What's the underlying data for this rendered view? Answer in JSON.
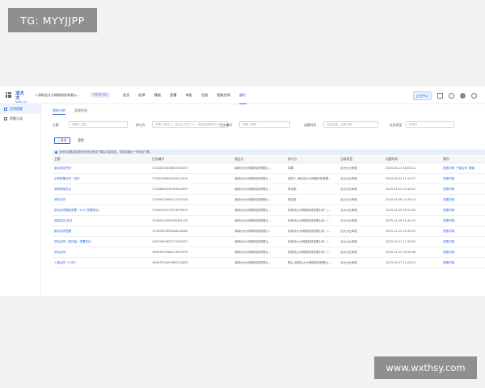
{
  "watermarks": {
    "top_left": "TG: MYYJJPP",
    "bottom_right": "www.wxthsy.com"
  },
  "header": {
    "logo_text": "法大大",
    "logo_sub": "fadada.com",
    "company": "＋深圳法大大网络科技有限公...",
    "company_badge": "已实名认证",
    "nav": [
      "首页",
      "起草",
      "模板",
      "签署",
      "审批",
      "归档",
      "智能合同",
      "履约"
    ],
    "active_nav_index": 7,
    "right_button": "企业中心"
  },
  "sidebar": {
    "items": [
      "定期提醒",
      "提醒记录"
    ],
    "active_index": 0
  },
  "tabs": {
    "items": [
      "我参与的",
      "全部任务"
    ],
    "active_index": 0
  },
  "filters": {
    "subject": {
      "label": "主题",
      "placeholder": "请输入主题"
    },
    "participant": {
      "label": "参与方",
      "placeholder": "请输入相对方，或企业下的个人，多选或选择参与方"
    },
    "contract_no": {
      "label": "任务编号",
      "placeholder": "请输入编号"
    },
    "date_range": {
      "label": "创建时间",
      "start": "开始日期",
      "sep": "-",
      "end": "结束日期"
    },
    "type": {
      "label": "任务类型",
      "placeholder": "请选择"
    },
    "query_button": "查询",
    "reset_button": "重置"
  },
  "notice": "多份合同数量较多时分批次完成下载后才能发送，仅保存最近一份导出下载。",
  "table": {
    "columns": [
      "主题",
      "任务编号",
      "发起方",
      "参与方",
      "当前类型",
      "创建时间",
      "操作"
    ],
    "rows": [
      {
        "subject": "演示测试任务",
        "id": "17183534438607433247",
        "initiator": "深圳法大大网络科技有限公...",
        "participant": "本期",
        "type": "法大大云审批",
        "date": "2024-05-13 18:04:11",
        "actions": [
          "查看详情",
          "下载合同",
          "撤销"
        ]
      },
      {
        "subject": "示例签署合同 · 测评",
        "id": "17182508924499123010",
        "initiator": "深圳法大大网络科技有限公...",
        "participant": "测评人 深圳法大大网络科技有限...",
        "type": "法大大云审批",
        "date": "2024-05-24 11:14:27",
        "actions": [
          "查看详情"
        ]
      },
      {
        "subject": "采购框架协议",
        "id": "17164884539304430937",
        "initiator": "深圳法大大网络科技有限公...",
        "participant": "财务部",
        "type": "法大大云审批",
        "date": "2024-01-04 14:16:47",
        "actions": [
          "查看详情"
        ]
      },
      {
        "subject": "采购合同",
        "id": "17165623563112103233",
        "initiator": "深圳法大大网络科技有限公...",
        "participant": "财务部",
        "type": "法大大云审批",
        "date": "2024-01-06 14:35:11",
        "actions": [
          "查看详情"
        ]
      },
      {
        "subject": "劳动合同模板签署（10人·签署协议）",
        "id": "17050233771921076417",
        "initiator": "深圳法大大网络科技有限公...",
        "participant": "深圳法大大网络科技有限公司（...",
        "type": "法大大云审批",
        "date": "2023-11-09 10:23:41",
        "actions": [
          "查看详情"
        ]
      },
      {
        "subject": "保密协议-测试",
        "id": "17063141693560481132",
        "initiator": "深圳法大大网络科技有限公...",
        "participant": "深圳法大大网络科技有限公司（...",
        "type": "法大大云审批",
        "date": "2023-11-28 11:40:12",
        "actions": [
          "查看详情"
        ]
      },
      {
        "subject": "服务合同签署",
        "id": "17067654595484246402",
        "initiator": "深圳法大大网络科技有限公...",
        "participant": "深圳法大大网络科技有限公司（...",
        "type": "法大大云审批",
        "date": "2023-11-24 10:50:23",
        "actions": [
          "查看详情"
        ]
      },
      {
        "subject": "项目合同（测评版）签署协议",
        "id": "16971655937717449327",
        "initiator": "深圳法大大网络科技有限公...",
        "participant": "深圳法大大网络科技有限公司（...",
        "type": "法大大云审批",
        "date": "2023-10-31 17:43:52",
        "actions": [
          "查看详情"
        ]
      },
      {
        "subject": "劳动合同",
        "id": "16913502360214905279",
        "initiator": "深圳法大大网络科技有限公...",
        "participant": "深圳法大大网络科技有限公司（...",
        "type": "法大大云审批",
        "date": "2023-11-02 20:09:46",
        "actions": [
          "查看详情"
        ]
      },
      {
        "subject": "人事合同（10份）",
        "id": "16567534397890734803",
        "initiator": "深圳法大大网络科技有限公...",
        "participant": "默认 深圳法大大网络科技有限公...",
        "type": "法大大云审批",
        "date": "2023-09-27 11:08:15",
        "actions": [
          "查看详情"
        ]
      }
    ]
  },
  "colors": {
    "accent": "#2f6ae0",
    "notice_bg": "#e7efff",
    "badge_bg": "#e9eafd"
  }
}
